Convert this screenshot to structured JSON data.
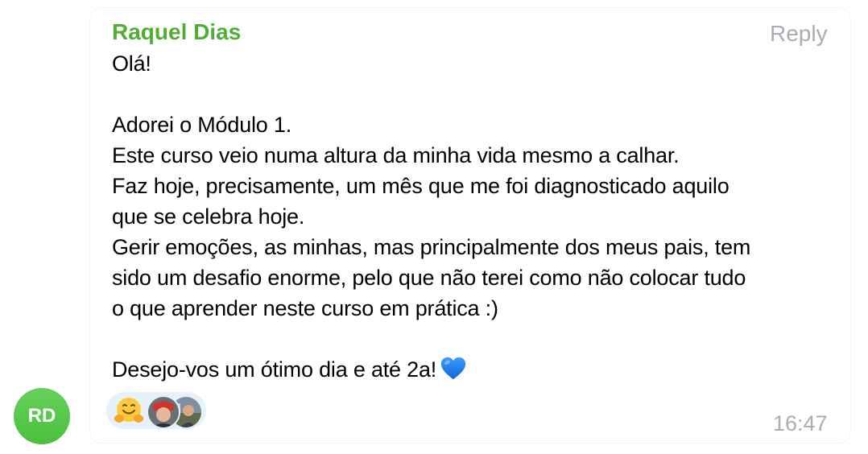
{
  "message": {
    "sender": "Raquel Dias",
    "reply_label": "Reply",
    "text": "Olá!\n\nAdorei o Módulo 1.\nEste curso veio numa altura da minha vida mesmo a calhar.\nFaz hoje, precisamente, um mês que me foi diagnosticado aquilo\nque se celebra hoje.\nGerir emoções, as minhas, mas principalmente dos meus pais, tem\nsido um desafio enorme, pelo que não terei como não colocar tudo\no que aprender neste curso em prática :)\n\nDesejo-vos um ótimo dia e até 2a!",
    "emoji": "blue-heart-icon",
    "time": "16:47"
  },
  "avatar": {
    "initials": "RD",
    "color": "#4fbf44"
  },
  "reactions": {
    "emoji": "hugging-face-icon",
    "reactor_avatars": [
      "user-avatar",
      "user-avatar"
    ]
  },
  "colors": {
    "sender_name": "#4fae33",
    "muted_text": "#a8adb3",
    "reaction_bg": "#e7f1fa",
    "heart": "#1f7ff0"
  }
}
